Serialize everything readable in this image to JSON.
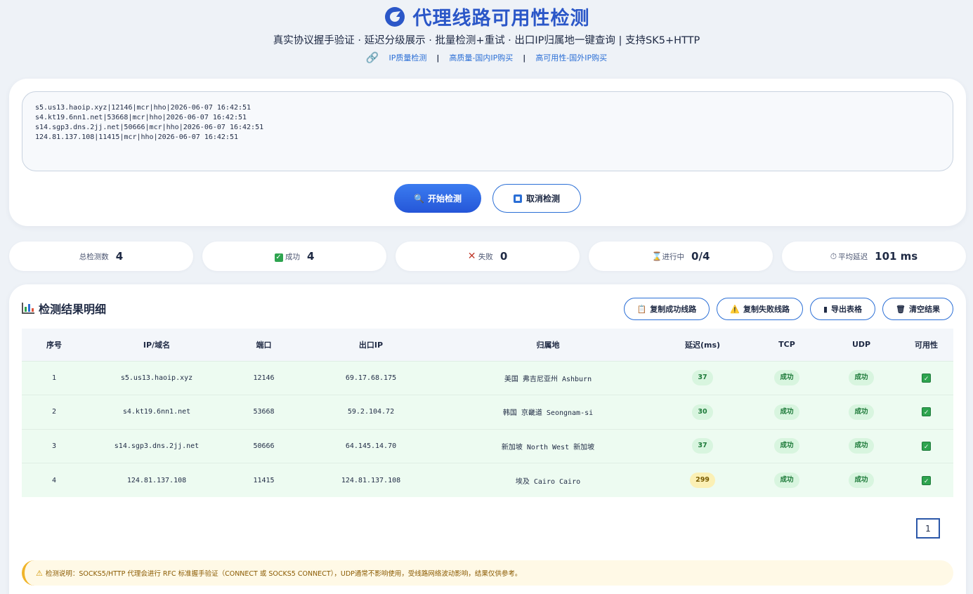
{
  "header": {
    "title": "代理线路可用性检测",
    "subtitle": "真实协议握手验证 · 延迟分级展示 · 批量检测+重试 · 出口IP归属地一键查询 | 支持SK5+HTTP",
    "links": [
      {
        "label": "IP质量检测"
      },
      {
        "label": "高质量-国内IP购买"
      },
      {
        "label": "高可用性-国外IP购买"
      }
    ],
    "link_separator": "|"
  },
  "input": {
    "value": "s5.us13.haoip.xyz|12146|mcr|hho|2026-06-07 16:42:51\ns4.kt19.6nn1.net|53668|mcr|hho|2026-06-07 16:42:51\ns14.sgp3.dns.2jj.net|50666|mcr|hho|2026-06-07 16:42:51\n124.81.137.108|11415|mcr|hho|2026-06-07 16:42:51"
  },
  "buttons": {
    "start": "开始检测",
    "cancel": "取消检测"
  },
  "stats": {
    "total_label": "总检测数",
    "total_value": "4",
    "success_label": "成功",
    "success_value": "4",
    "fail_label": "失败",
    "fail_value": "0",
    "progress_label": "进行中",
    "progress_value": "0/4",
    "latency_label": "平均延迟",
    "latency_value": "101 ms"
  },
  "results": {
    "title": "检测结果明细",
    "actions": {
      "copy_success": "复制成功线路",
      "copy_fail": "复制失败线路",
      "export": "导出表格",
      "clear": "清空结果"
    },
    "columns": [
      "序号",
      "IP/域名",
      "端口",
      "出口IP",
      "归属地",
      "延迟(ms)",
      "TCP",
      "UDP",
      "可用性"
    ],
    "rows": [
      {
        "index": "1",
        "host": "s5.us13.haoip.xyz",
        "port": "12146",
        "exit_ip": "69.17.68.175",
        "location": "美国 弗吉尼亚州 Ashburn",
        "latency": "37",
        "latency_level": "good",
        "tcp": "成功",
        "udp": "成功",
        "available": true
      },
      {
        "index": "2",
        "host": "s4.kt19.6nn1.net",
        "port": "53668",
        "exit_ip": "59.2.104.72",
        "location": "韩国 京畿道 Seongnam-si",
        "latency": "30",
        "latency_level": "good",
        "tcp": "成功",
        "udp": "成功",
        "available": true
      },
      {
        "index": "3",
        "host": "s14.sgp3.dns.2jj.net",
        "port": "50666",
        "exit_ip": "64.145.14.70",
        "location": "新加坡 North West 新加坡",
        "latency": "37",
        "latency_level": "good",
        "tcp": "成功",
        "udp": "成功",
        "available": true
      },
      {
        "index": "4",
        "host": "124.81.137.108",
        "port": "11415",
        "exit_ip": "124.81.137.108",
        "location": "埃及 Cairo Cairo",
        "latency": "299",
        "latency_level": "slow",
        "tcp": "成功",
        "udp": "成功",
        "available": true
      }
    ],
    "page": "1",
    "notice": "检测说明：SOCKS5/HTTP 代理会进行 RFC 标准握手验证（CONNECT 或 SOCKS5 CONNECT），UDP通常不影响使用，受线路网络波动影响，结果仅供参考。"
  },
  "colors": {
    "brand": "#2b57c8",
    "accent": "#2b6fd6",
    "success_row": "#edfbf1",
    "latency_good": "#d8f5df",
    "latency_slow": "#fbf0b5"
  }
}
